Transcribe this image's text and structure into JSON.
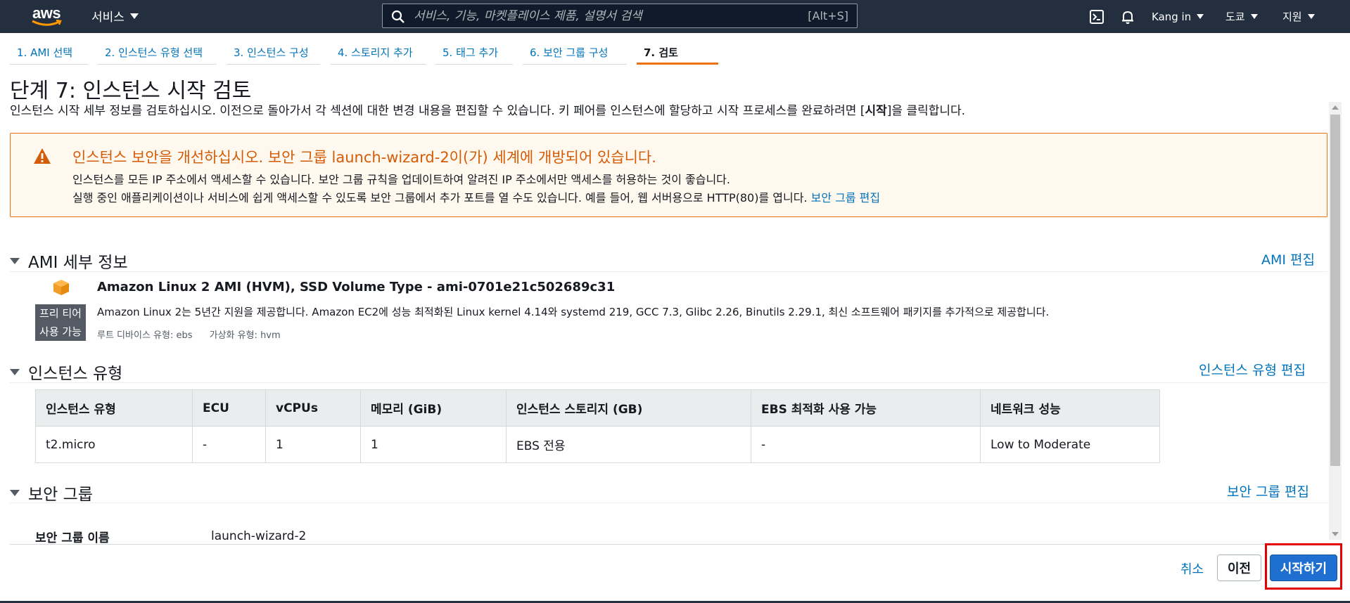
{
  "topnav": {
    "logo_text": "aws",
    "services_label": "서비스",
    "search_placeholder": "서비스, 기능, 마켓플레이스 제품, 설명서 검색",
    "search_shortcut": "[Alt+S]",
    "user_label": "Kang in",
    "region_label": "도쿄",
    "support_label": "지원"
  },
  "steps": [
    {
      "label": "1. AMI 선택"
    },
    {
      "label": "2. 인스턴스 유형 선택"
    },
    {
      "label": "3. 인스턴스 구성"
    },
    {
      "label": "4. 스토리지 추가"
    },
    {
      "label": "5. 태그 추가"
    },
    {
      "label": "6. 보안 그룹 구성"
    },
    {
      "label": "7. 검토"
    }
  ],
  "page": {
    "title": "단계 7: 인스턴스 시작 검토",
    "subtitle_before": "인스턴스 시작 세부 정보를 검토하십시오. 이전으로 돌아가서 각 섹션에 대한 변경 내용을 편집할 수 있습니다. 키 페어를 인스턴스에 할당하고 시작 프로세스를 완료하려면 [",
    "subtitle_bold": "시작",
    "subtitle_after": "]을 클릭합니다."
  },
  "warning": {
    "title": "인스턴스 보안을 개선하십시오. 보안 그룹 launch-wizard-2이(가) 세계에 개방되어 있습니다.",
    "line1": "인스턴스를 모든 IP 주소에서 액세스할 수 있습니다. 보안 그룹 규칙을 업데이트하여 알려진 IP 주소에서만 액세스를 허용하는 것이 좋습니다.",
    "line2": "실행 중인 애플리케이션이나 서비스에 쉽게 액세스할 수 있도록 보안 그룹에서 추가 포트를 열 수도 있습니다. 예를 들어, 웹 서버용으로 HTTP(80)를 엽니다.",
    "link": "보안 그룹 편집",
    "color": "#ec7211"
  },
  "ami": {
    "heading": "AMI 세부 정보",
    "edit_link": "AMI 편집",
    "badge_line1": "프리 티어",
    "badge_line2": "사용 가능",
    "name": "Amazon Linux 2 AMI (HVM), SSD Volume Type - ami-0701e21c502689c31",
    "description": "Amazon Linux 2는 5년간 지원을 제공합니다. Amazon EC2에 성능 최적화된 Linux kernel 4.14와 systemd 219, GCC 7.3, Glibc 2.26, Binutils 2.29.1, 최신 소프트웨어 패키지를 추가적으로 제공합니다.",
    "root_device": "루트 디바이스 유형: ebs",
    "virtualization": "가상화 유형: hvm"
  },
  "instance_type": {
    "heading": "인스턴스 유형",
    "edit_link": "인스턴스 유형 편집",
    "columns": [
      "인스턴스 유형",
      "ECU",
      "vCPUs",
      "메모리 (GiB)",
      "인스턴스 스토리지 (GB)",
      "EBS 최적화 사용 가능",
      "네트워크 성능"
    ],
    "row": [
      "t2.micro",
      "-",
      "1",
      "1",
      "EBS 전용",
      "-",
      "Low to Moderate"
    ]
  },
  "security_group": {
    "heading": "보안 그룹",
    "edit_link": "보안 그룹 편집",
    "name_label": "보안 그룹 이름",
    "name_value": "launch-wizard-2"
  },
  "footer": {
    "cancel": "취소",
    "previous": "이전",
    "launch": "시작하기",
    "launch_color": "#1f6fd0",
    "highlight_color": "#e30000"
  }
}
